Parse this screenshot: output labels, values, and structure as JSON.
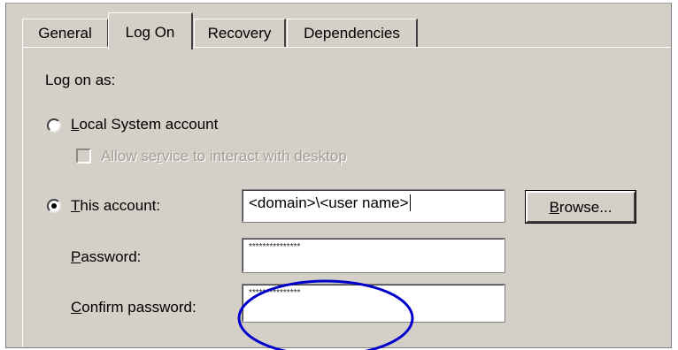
{
  "tabs": [
    {
      "label": "General"
    },
    {
      "label": "Log On"
    },
    {
      "label": "Recovery"
    },
    {
      "label": "Dependencies"
    }
  ],
  "logon": {
    "heading": "Log on as:",
    "local_system_label": "Local System account",
    "interact_desktop_label": "Allow service to interact with desktop",
    "this_account_label": "This account:",
    "account_value": "<domain>\\<user name>",
    "browse_label": "Browse...",
    "password_label": "Password:",
    "password_value": "***************",
    "confirm_label": "Confirm password:",
    "confirm_value": "***************"
  },
  "annotation": {
    "color": "#0000cc"
  }
}
